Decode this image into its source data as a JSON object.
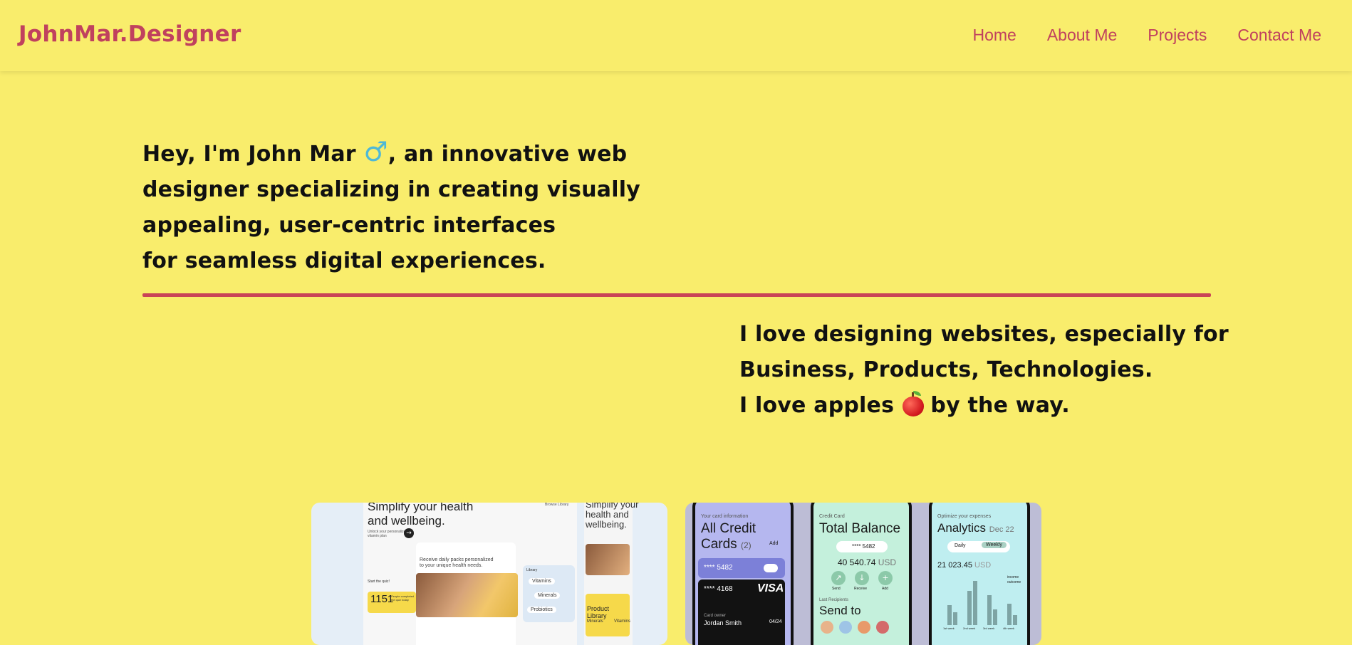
{
  "nav": {
    "brand": "JohnMar.Designer",
    "links": [
      "Home",
      "About Me",
      "Projects",
      "Contact Me"
    ]
  },
  "intro": {
    "line1_a": "Hey, I'm John Mar ",
    "male_symbol": "♂",
    "line1_b": ", an innovative web",
    "line2": "designer specializing in creating visually",
    "line3": "appealing, user-centric interfaces",
    "line4": "for seamless digital experiences."
  },
  "love": {
    "line1": "I love designing websites, especially for",
    "line2": "Business, Products, Technologies.",
    "line3_a": "I love apples ",
    "line3_b": " by the way."
  },
  "project1": {
    "title_line1": "Simplify your health",
    "title_line2": "and wellbeing.",
    "side_title_line1": "Simplify your",
    "side_title_line2": "health and",
    "side_title_line3": "wellbeing.",
    "browse": "Browse Library",
    "subtitle_line1": "Unlock your personalized",
    "subtitle_line2": "vitamin plan",
    "panel_text_line1": "Receive daily packs personalized",
    "panel_text_line2": "to your unique health needs.",
    "quiz": "Start the quiz!",
    "stat_number": "1151",
    "stat_text_line1": "People completed",
    "stat_text_line2": "the quiz today",
    "library_label": "Library",
    "pills": [
      "Vitamins",
      "Minerals",
      "Probiotics"
    ],
    "side_card_line1": "Product",
    "side_card_line2": "Library",
    "side_minerals": "Minerals",
    "side_vitamins": "Vitamins"
  },
  "project2": {
    "phone1": {
      "tag": "Your card information",
      "title_line1": "All Credit",
      "title_line2": "Cards",
      "count": "(2)",
      "add": "Add",
      "card1_number": "**** 5482",
      "card2_number": "**** 4168",
      "card2_brand": "VISA",
      "owner_label": "Card owner",
      "owner": "Jordan Smith",
      "expiry": "04/24"
    },
    "phone2": {
      "tag": "Credit Card",
      "title": "Total Balance",
      "card_number": "**** 5482",
      "amount": "40 540.74",
      "currency": "USD",
      "actions": [
        "Send",
        "Receive",
        "Add"
      ],
      "recipients_label": "Last Recipients",
      "send_to": "Send to"
    },
    "phone3": {
      "tag": "Optimize your expenses",
      "title": "Analytics",
      "period": "Dec 22",
      "toggle": [
        "Daily",
        "Weekly"
      ],
      "amount": "21 023.45",
      "currency": "USD",
      "legend": [
        "income",
        "outcome"
      ],
      "week_labels": [
        "1st week",
        "2nd week",
        "3rd week",
        "4th week"
      ]
    }
  }
}
